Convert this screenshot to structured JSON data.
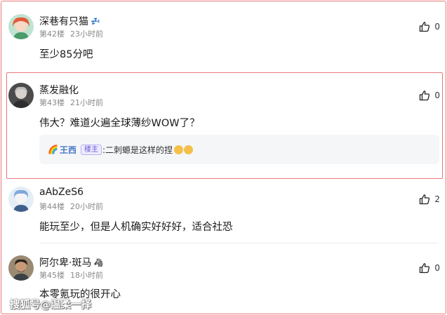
{
  "comments": [
    {
      "username": "深巷有只猫",
      "badge": "💤",
      "floor": "第42楼",
      "time": "23小时前",
      "content": "至少85分吧",
      "likes": "0"
    },
    {
      "username": "蒸发融化",
      "floor": "第43楼",
      "time": "21小时前",
      "content": "伟大？难道火遍全球薄纱WOW了？",
      "likes": "0",
      "reply": {
        "prefix_icon": "🌈",
        "name": "王西",
        "tag": "楼主",
        "text": ":二刺螈是这样的捏"
      }
    },
    {
      "username": "aAbZeS6",
      "floor": "第44楼",
      "time": "20小时前",
      "content": "能玩至少，但是人机确实好好好，适合社恐",
      "likes": "2"
    },
    {
      "username": "阿尔卑·斑马",
      "badge": "🦓",
      "floor": "第45楼",
      "time": "18小时前",
      "content": "本零氪玩的很开心",
      "likes": "0"
    }
  ],
  "watermark": "搜狐号@温柔一择",
  "colors": {
    "highlight_border": "#e8787a",
    "reply_name": "#4a78c8",
    "meta_text": "#8a8a8a"
  },
  "icons": {
    "like": "thumbs-up-icon"
  }
}
